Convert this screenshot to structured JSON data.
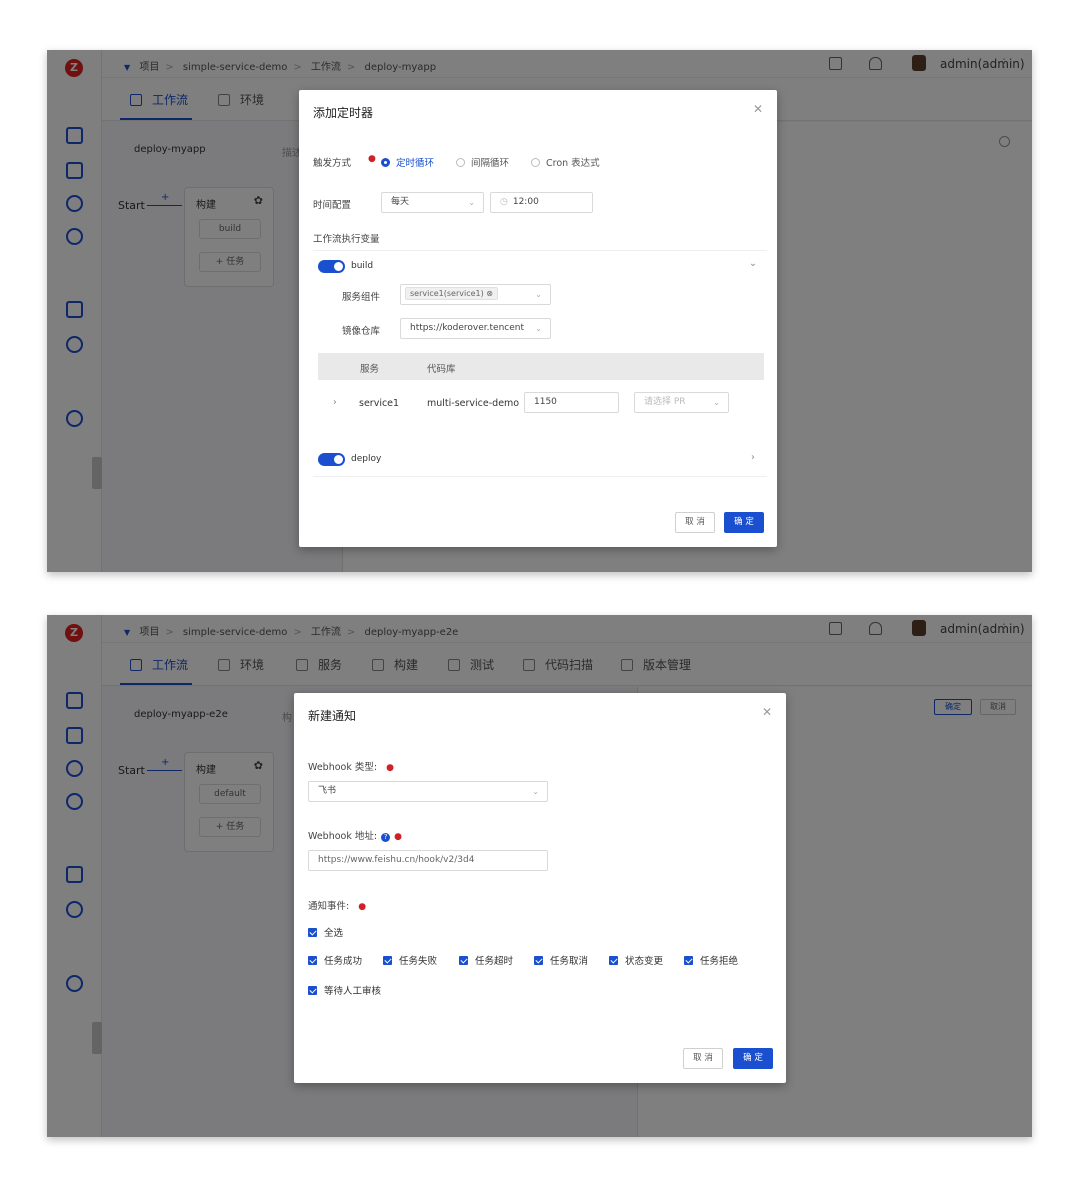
{
  "app": {
    "user": "admin(admin)",
    "breadcrumb": {
      "project": "项目",
      "project_name": "simple-service-demo",
      "workflow": "工作流"
    }
  },
  "screen1": {
    "breadcrumb_current": "deploy-myapp",
    "tabs": [
      "工作流",
      "环境"
    ],
    "workflow_name": "deploy-myapp",
    "workflow_hint": "描述",
    "flow": {
      "start": "Start",
      "stage": "构建",
      "job": "build",
      "add_task": "+ 任务"
    },
    "modal": {
      "title": "添加定时器",
      "trigger_label": "触发方式",
      "trigger_options": [
        "定时循环",
        "间隔循环",
        "Cron 表达式"
      ],
      "trigger_selected": "定时循环",
      "time_label": "时间配置",
      "time_frequency": "每天",
      "time_value": "12:00",
      "vars_label": "工作流执行变量",
      "build": {
        "toggle_label": "build",
        "service_label": "服务组件",
        "service_tag": "service1(service1)",
        "registry_label": "镜像仓库",
        "registry_value": "https://koderover.tencent",
        "table_headers": [
          "服务",
          "代码库"
        ],
        "row": {
          "service": "service1",
          "repo": "multi-service-demo",
          "branch": "1150",
          "pr_placeholder": "请选择 PR"
        }
      },
      "deploy": {
        "toggle_label": "deploy"
      },
      "cancel": "取 消",
      "confirm": "确 定"
    }
  },
  "screen2": {
    "breadcrumb_current": "deploy-myapp-e2e",
    "tabs": [
      "工作流",
      "环境",
      "服务",
      "构建",
      "测试",
      "代码扫描",
      "版本管理"
    ],
    "workflow_name": "deploy-myapp-e2e",
    "workflow_hint": "构",
    "flow": {
      "start": "Start",
      "stage": "构建",
      "job": "default",
      "add_task": "+ 任务"
    },
    "panel_buttons": {
      "confirm": "确定",
      "cancel": "取消"
    },
    "modal": {
      "title": "新建通知",
      "webhook_type_label": "Webhook 类型:",
      "webhook_type_value": "飞书",
      "webhook_url_label": "Webhook 地址:",
      "webhook_url_value": "https://www.feishu.cn/hook/v2/3d4",
      "events_label": "通知事件:",
      "select_all": "全选",
      "events": [
        "任务成功",
        "任务失败",
        "任务超时",
        "任务取消",
        "状态变更",
        "任务拒绝",
        "等待人工审核"
      ],
      "cancel": "取 消",
      "confirm": "确 定"
    }
  }
}
